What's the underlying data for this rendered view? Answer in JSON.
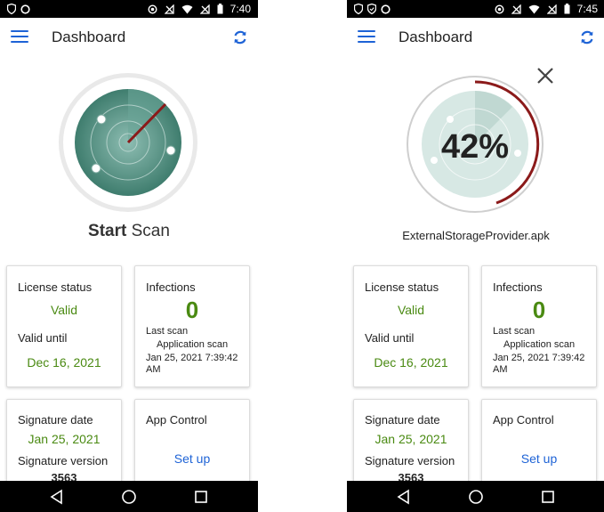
{
  "screens": [
    {
      "status_time": "7:40",
      "title": "Dashboard",
      "scan_label_bold": "Start",
      "scan_label_rest": " Scan",
      "license_status_label": "License status",
      "license_status_value": "Valid",
      "valid_until_label": "Valid until",
      "valid_until_value": "Dec 16, 2021",
      "infections_label": "Infections",
      "infections_count": "0",
      "last_scan_label": "Last scan",
      "last_scan_type": "Application scan",
      "last_scan_time_1": "Jan 25, 2021 7:39:42",
      "last_scan_time_2": "AM",
      "signature_date_label": "Signature date",
      "signature_date_value": "Jan 25, 2021",
      "signature_version_label": "Signature version",
      "signature_version_value": "3563",
      "app_control_label": "App Control",
      "setup_link": "Set up"
    },
    {
      "status_time": "7:45",
      "title": "Dashboard",
      "scan_progress": "42%",
      "scan_file": "ExternalStorageProvider.apk",
      "license_status_label": "License status",
      "license_status_value": "Valid",
      "valid_until_label": "Valid until",
      "valid_until_value": "Dec 16, 2021",
      "infections_label": "Infections",
      "infections_count": "0",
      "last_scan_label": "Last scan",
      "last_scan_type": "Application scan",
      "last_scan_time_1": "Jan 25, 2021 7:39:42",
      "last_scan_time_2": "AM",
      "signature_date_label": "Signature date",
      "signature_date_value": "Jan 25, 2021",
      "signature_version_label": "Signature version",
      "signature_version_value": "3563",
      "app_control_label": "App Control",
      "setup_link": "Set up"
    }
  ],
  "colors": {
    "accent_blue": "#1e63d6",
    "valid_green": "#4a8a12",
    "radar_teal": "#4f8f80",
    "sweep_red": "#8b1a1a"
  }
}
